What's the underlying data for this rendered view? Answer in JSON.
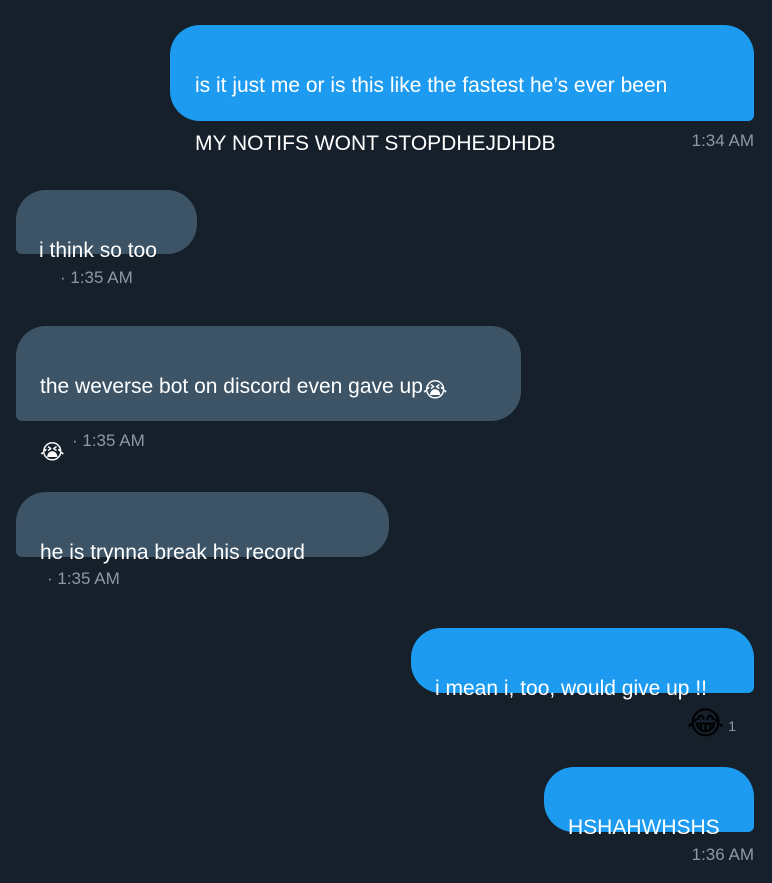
{
  "messages": [
    {
      "line1": "is it just me or is this like the fastest he’s ever been",
      "line2": "MY NOTIFS WONT STOPDHEJDHDB",
      "time": "1:34 AM"
    },
    {
      "text": "i think so too",
      "time": "· 1:35 AM"
    },
    {
      "text": "the weverse bot on discord even gave up",
      "emoji": "😭",
      "time": "· 1:35 AM"
    },
    {
      "text": "he is trynna break his record",
      "time": "· 1:35 AM"
    },
    {
      "text": "i mean i, too, would give up !!",
      "reaction": {
        "emoji": "😂",
        "count": "1"
      }
    },
    {
      "text": "HSHAHWHSHS",
      "time": "1:36 AM"
    }
  ],
  "colors": {
    "background": "#15202b",
    "sent_bubble": "#1d9bf0",
    "received_bubble": "#3d5466",
    "timestamp": "#8b98a5"
  }
}
